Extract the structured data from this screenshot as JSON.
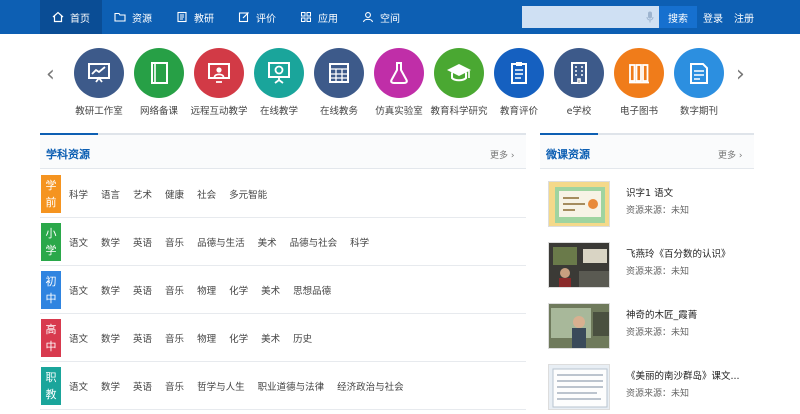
{
  "nav": {
    "items": [
      {
        "label": "首页",
        "icon": "home-icon"
      },
      {
        "label": "资源",
        "icon": "folder-icon"
      },
      {
        "label": "教研",
        "icon": "book-icon"
      },
      {
        "label": "评价",
        "icon": "edit-icon"
      },
      {
        "label": "应用",
        "icon": "apps-grid-icon"
      },
      {
        "label": "空间",
        "icon": "user-icon"
      }
    ],
    "search_placeholder": "",
    "search_button": "搜索",
    "login": "登录",
    "register": "注册"
  },
  "categories": [
    {
      "label": "教研工作室",
      "color": "#3d5a8a",
      "icon": "presentation-chart-icon"
    },
    {
      "label": "网络备课",
      "color": "#27a046",
      "icon": "notebook-icon"
    },
    {
      "label": "远程互动教学",
      "color": "#d23a46",
      "icon": "remote-teaching-icon"
    },
    {
      "label": "在线教学",
      "color": "#1aa59b",
      "icon": "online-board-icon"
    },
    {
      "label": "在线教务",
      "color": "#3d5a8a",
      "icon": "calendar-table-icon"
    },
    {
      "label": "仿真实验室",
      "color": "#c02ea8",
      "icon": "flask-icon"
    },
    {
      "label": "教育科学研究",
      "color": "#4aa832",
      "icon": "graduation-cap-icon"
    },
    {
      "label": "教育评价",
      "color": "#1560c0",
      "icon": "clipboard-icon"
    },
    {
      "label": "e学校",
      "color": "#3d5a8a",
      "icon": "building-icon"
    },
    {
      "label": "电子图书",
      "color": "#f07c1a",
      "icon": "books-icon"
    },
    {
      "label": "数字期刊",
      "color": "#2c8fe0",
      "icon": "journal-icon"
    }
  ],
  "subject_panel": {
    "title": "学科资源",
    "more": "更多",
    "rows": [
      {
        "badge": [
          "学",
          "前"
        ],
        "color": "#f59420",
        "subjects": [
          "科学",
          "语言",
          "艺术",
          "健康",
          "社会",
          "多元智能"
        ]
      },
      {
        "badge": [
          "小",
          "学"
        ],
        "color": "#2aa84a",
        "subjects": [
          "语文",
          "数学",
          "英语",
          "音乐",
          "品德与生活",
          "美术",
          "品德与社会",
          "科学"
        ]
      },
      {
        "badge": [
          "初",
          "中"
        ],
        "color": "#2f84e0",
        "subjects": [
          "语文",
          "数学",
          "英语",
          "音乐",
          "物理",
          "化学",
          "美术",
          "思想品德"
        ]
      },
      {
        "badge": [
          "高",
          "中"
        ],
        "color": "#d83a4e",
        "subjects": [
          "语文",
          "数学",
          "英语",
          "音乐",
          "物理",
          "化学",
          "美术",
          "历史"
        ]
      },
      {
        "badge": [
          "职",
          "教"
        ],
        "color": "#1aa59b",
        "subjects": [
          "语文",
          "数学",
          "英语",
          "音乐",
          "哲学与人生",
          "职业道德与法律",
          "经济政治与社会"
        ]
      }
    ]
  },
  "micro_panel": {
    "title": "微课资源",
    "more": "更多",
    "items": [
      {
        "title": "识字1 语文",
        "source": "资源来源：未知"
      },
      {
        "title": "飞燕玲《百分数的认识》",
        "source": "资源来源：未知"
      },
      {
        "title": "神奇的木匠_霞菁",
        "source": "资源来源：未知"
      },
      {
        "title": "《美丽的南沙群岛》课文...",
        "source": "资源来源：未知"
      }
    ]
  }
}
